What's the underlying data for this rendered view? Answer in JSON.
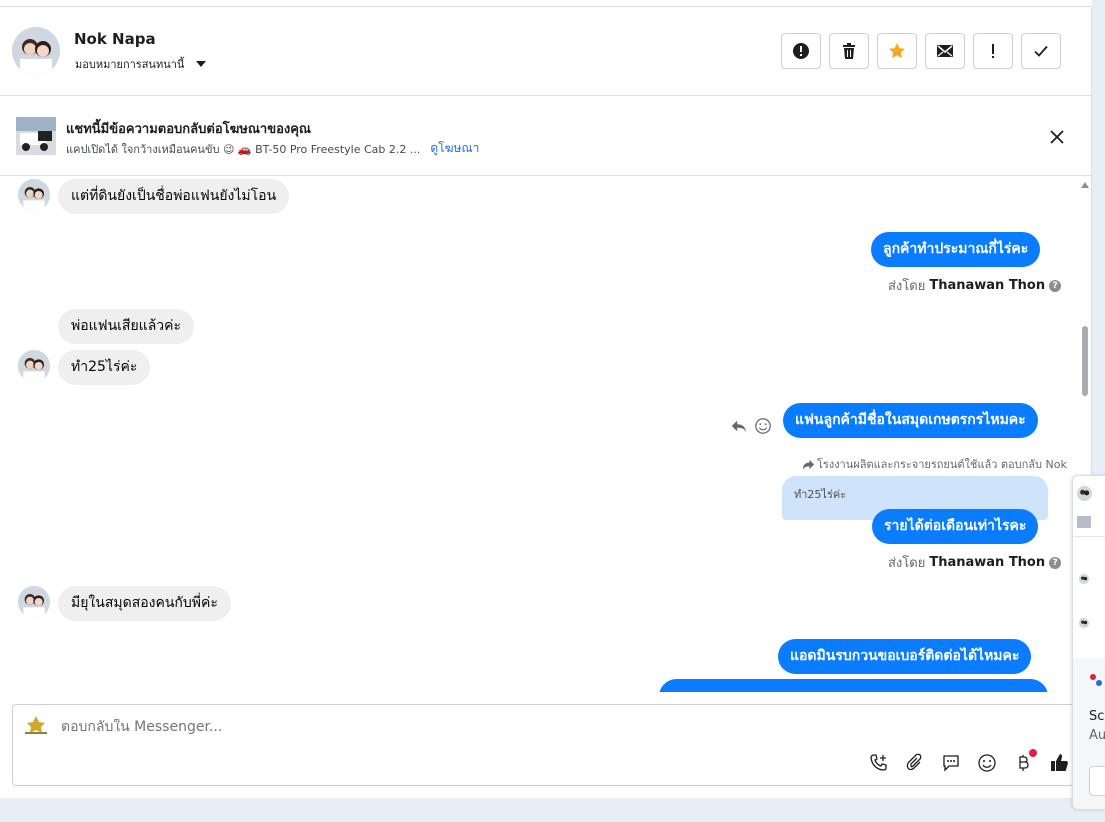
{
  "header": {
    "contact_name": "Nok Napa",
    "assign_label": "มอบหมายการสนทนานี้",
    "actions": [
      {
        "name": "mark-spam-button",
        "icon": "alert-circle-icon"
      },
      {
        "name": "delete-button",
        "icon": "trash-icon"
      },
      {
        "name": "star-button",
        "icon": "star-icon",
        "color": "#f5a623"
      },
      {
        "name": "mark-unread-button",
        "icon": "envelope-icon"
      },
      {
        "name": "follow-up-button",
        "icon": "exclamation-icon"
      },
      {
        "name": "mark-done-button",
        "icon": "checkmark-icon"
      }
    ]
  },
  "ad_banner": {
    "title": "แชทนี้มีข้อความตอบกลับต่อโฆษณาของคุณ",
    "subtitle": "แคปเปิดได้ ใจกว้างเหมือนคนขับ 😉 🚗 BT-50 Pro Freestyle Cab 2.2 ...",
    "link": "ดูโฆษณา"
  },
  "messages": {
    "m1": "แต่ที่ดินยังเป็นชื่อพ่อแฟนยังไม่โอน",
    "m2": "ลูกค้าทำประมาณกี่ไร่คะ",
    "m2_sent_prefix": "ส่งโดย",
    "m2_sent_name": "Thanawan Thon",
    "m3": "พ่อแฟนเสียแล้วค่ะ",
    "m4": "ทำ25ไร่ค่ะ",
    "m5": "แฟนลูกค้ามีชื่อในสมุดเกษตรกรไหมคะ",
    "reply_note": "โรงงานผลิตและกระจายรถยนต์ใช้แล้ว ตอบกลับ Nok",
    "quoted": "ทำ25ไร่ค่ะ",
    "m6": "รายได้ต่อเดือนเท่าไรคะ",
    "m6_sent_prefix": "ส่งโดย",
    "m6_sent_name": "Thanawan Thon",
    "m7": "มียุในสมุดสองคนกับพี่ค่ะ",
    "m8": "แอดมินรบกวนขอเบอร์ติดต่อได้ไหมคะ"
  },
  "composer": {
    "placeholder": "ตอบกลับใน Messenger..."
  },
  "side_popup": {
    "line1": "Scr",
    "line2": "Au"
  },
  "colors": {
    "outgoing_bubble": "#0a7cff",
    "incoming_bubble": "#efefef",
    "link": "#216fdb",
    "star": "#f5a623",
    "notification_dot": "#e41e3f"
  }
}
